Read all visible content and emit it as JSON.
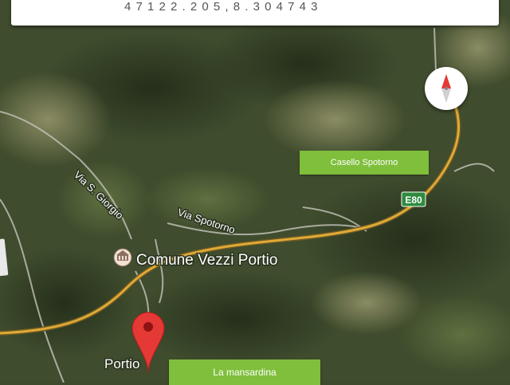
{
  "topbar": {
    "text": "4 7 1 2 2 . 2 0 5 , 8 . 3 0 4 7 4 3"
  },
  "map": {
    "labels": {
      "via_s_giorgio": "Via S. Giorgio",
      "via_spotorno": "Via Spotorno",
      "comune": "Comune Vezzi Portio",
      "portio": "Portio",
      "highway_shield": "E80"
    }
  },
  "buttons": {
    "casello": "Casello Spotorno",
    "mansardina": "La mansardina"
  },
  "colors": {
    "terrain_dark": "#2e3a22",
    "terrain_mid": "#4d5e36",
    "terrain_light": "#8a8d62",
    "highway": "#e0a937",
    "road": "#c9c9c9",
    "pin": "#e53935",
    "button_green": "#7fbf3c",
    "shield_green": "#2e8b3e"
  },
  "icons": {
    "compass": "compass-icon",
    "pin": "location-pin-icon",
    "poi": "town-hall-icon"
  }
}
